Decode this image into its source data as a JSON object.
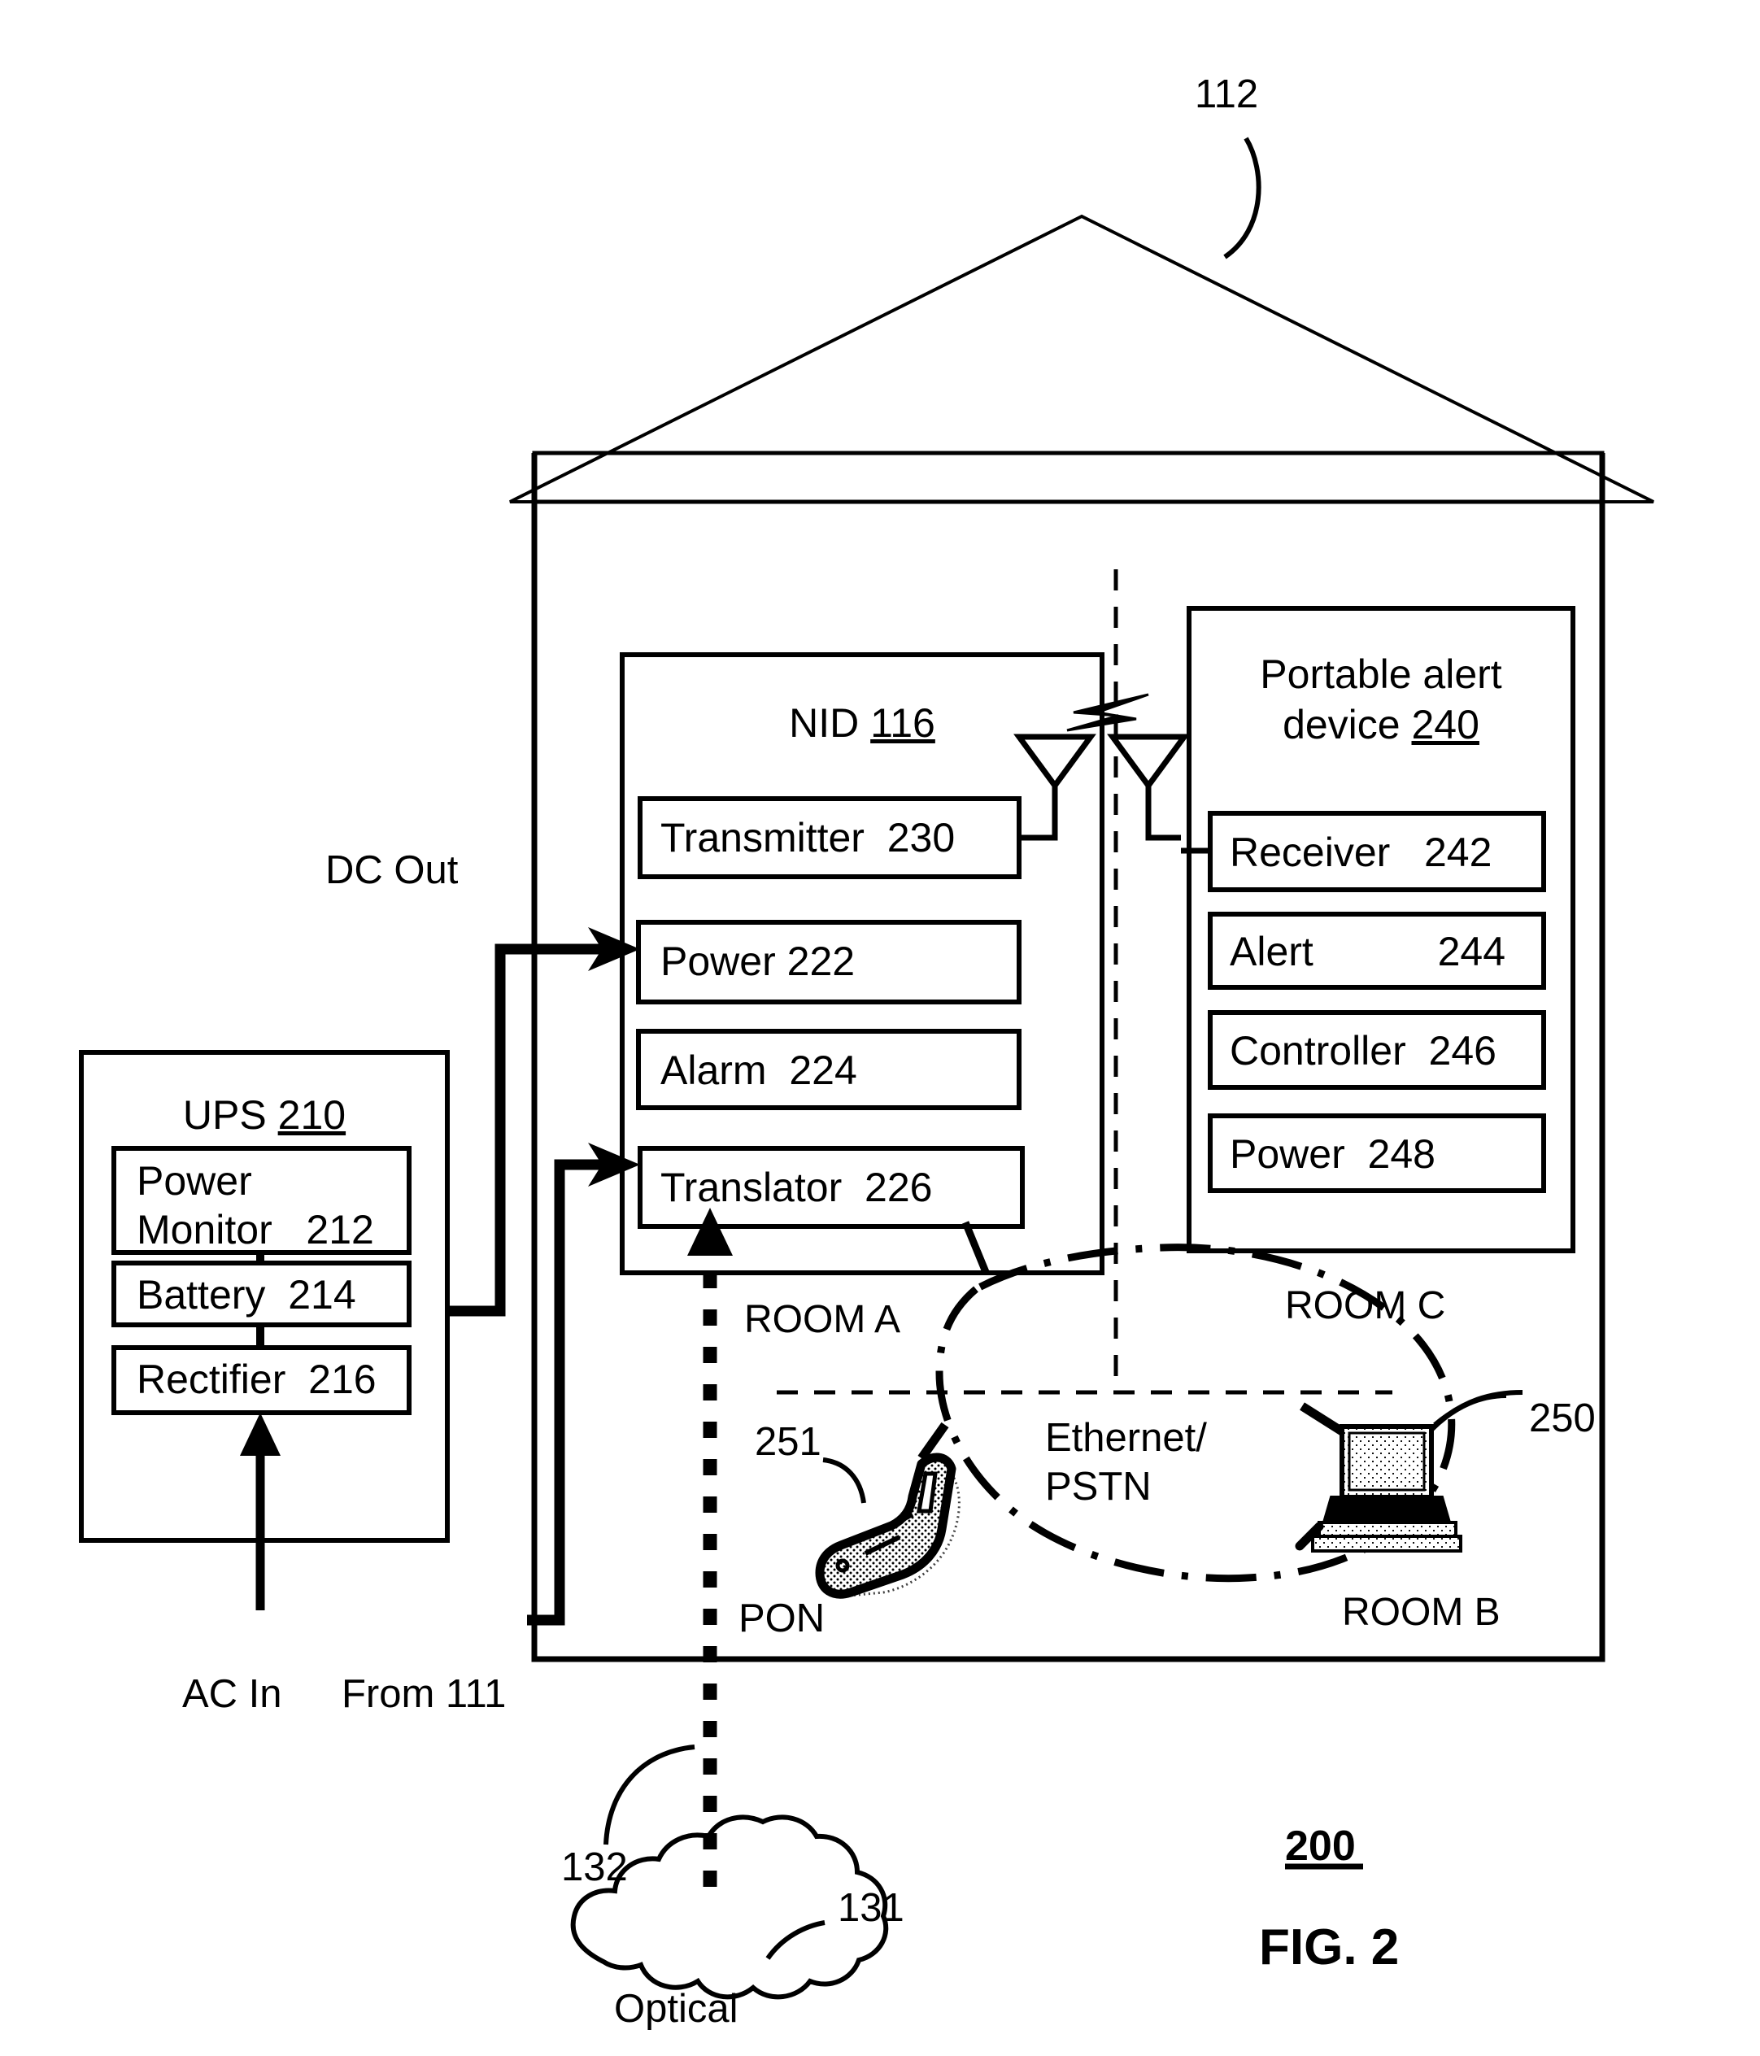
{
  "figure": {
    "number_label": "200",
    "caption": "FIG. 2"
  },
  "house": {
    "roof_ref": "112"
  },
  "nid": {
    "title_text": "NID",
    "title_ref": "116",
    "blocks": [
      {
        "label": "Transmitter",
        "ref": "230"
      },
      {
        "label": "Power",
        "ref": "222"
      },
      {
        "label": "Alarm",
        "ref": "224"
      },
      {
        "label": "Translator",
        "ref": "226"
      }
    ]
  },
  "portable_alert_device": {
    "title_line1": "Portable alert",
    "title_line2": "device",
    "title_ref": "240",
    "blocks": [
      {
        "label": "Receiver",
        "ref": "242"
      },
      {
        "label": "Alert",
        "ref": "244"
      },
      {
        "label": "Controller",
        "ref": "246"
      },
      {
        "label": "Power",
        "ref": "248"
      }
    ]
  },
  "ups": {
    "title_text": "UPS",
    "title_ref": "210",
    "blocks": [
      {
        "label_line1": "Power",
        "label_line2": "Monitor",
        "ref": "212"
      },
      {
        "label": "Battery",
        "ref": "214"
      },
      {
        "label": "Rectifier",
        "ref": "216"
      }
    ]
  },
  "labels": {
    "dc_out": "DC Out",
    "ac_in": "AC In",
    "from_111": "From 111",
    "pon": "PON",
    "room_a": "ROOM A",
    "room_b": "ROOM B",
    "room_c": "ROOM C",
    "network_line1": "Ethernet/",
    "network_line2": "PSTN",
    "optical_cloud": "Optical"
  },
  "refs": {
    "fiber_line": "132",
    "optical_network": "131",
    "computer": "250",
    "phone": "251"
  },
  "colors": {
    "ink": "#000000",
    "paper": "#ffffff",
    "stipple": "#000000"
  }
}
